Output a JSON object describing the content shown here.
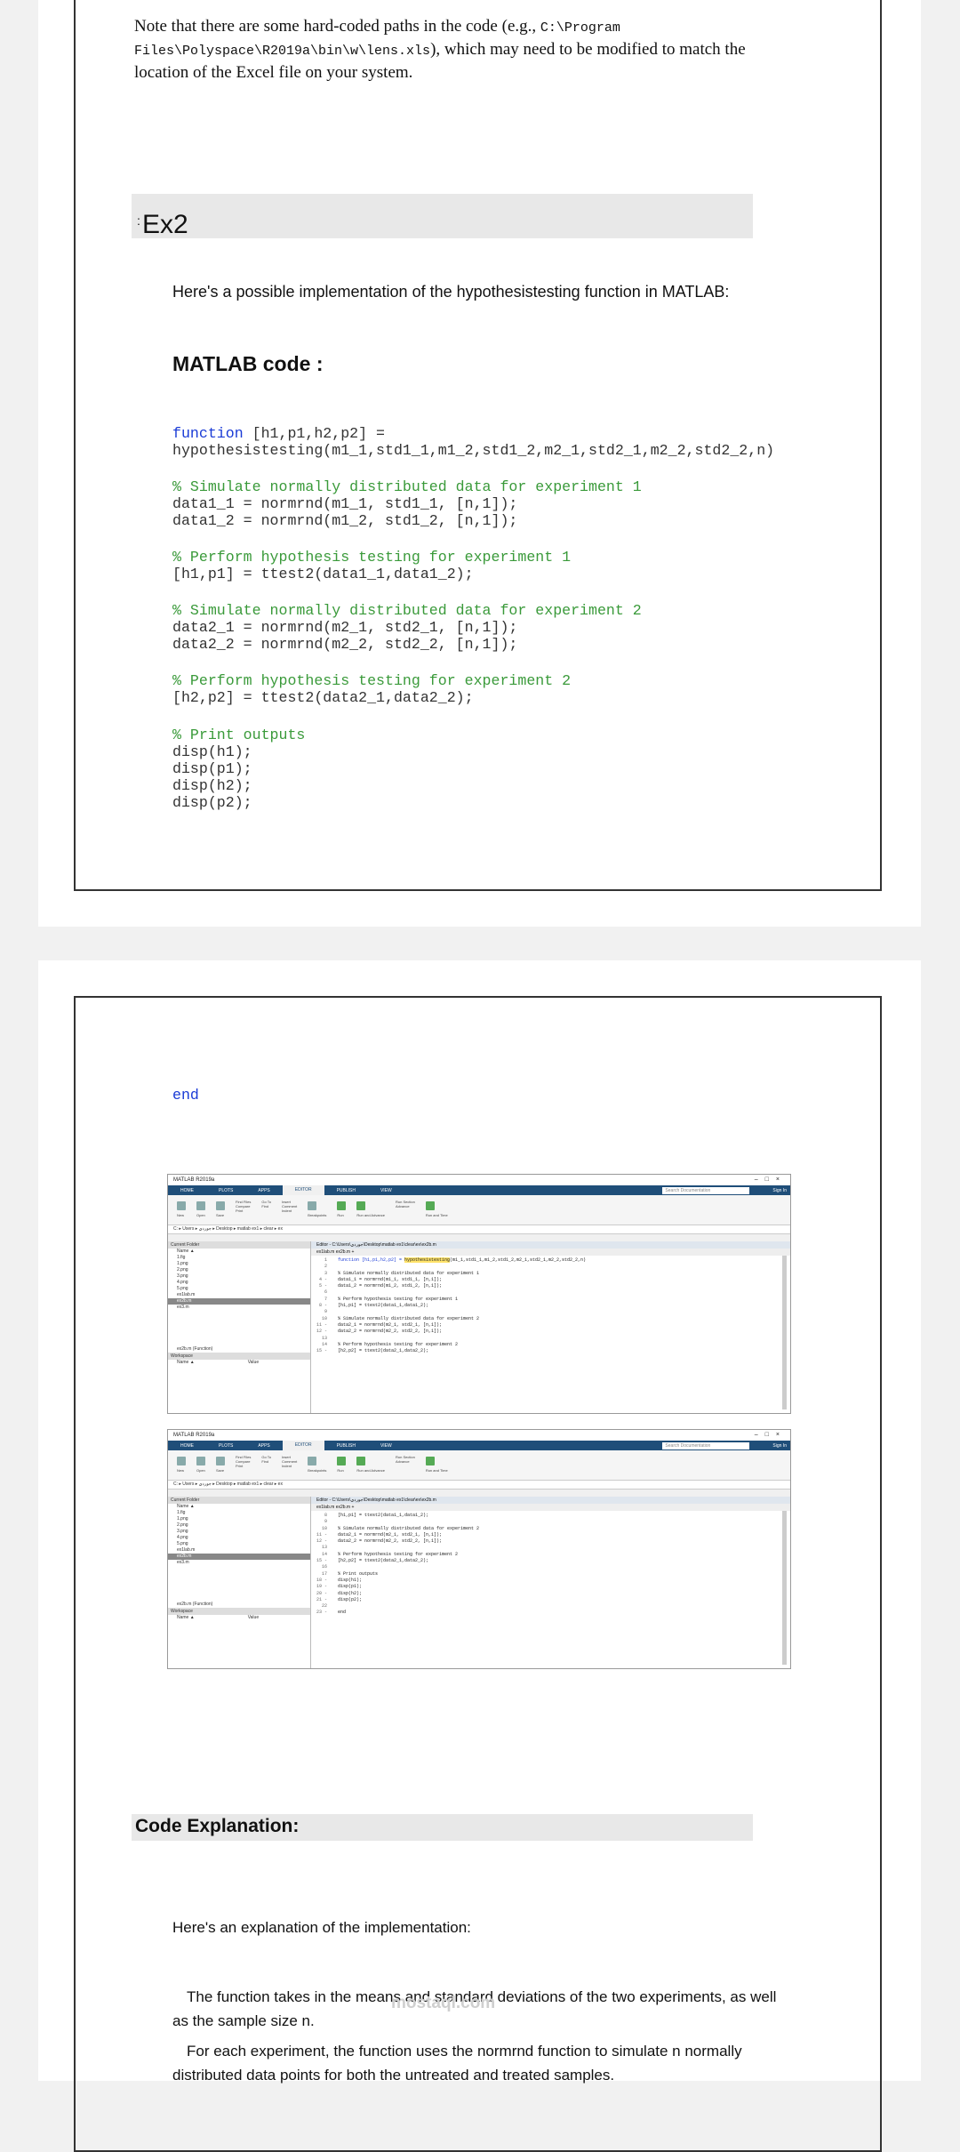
{
  "note": {
    "prefix": "Note that there are some hard-coded paths in the code (e.g., ",
    "path": "C:\\Program Files\\Polyspace\\R2019a\\bin\\w\\lens.xls",
    "suffix": "), which may need to be modified to match the location of the Excel file on your system."
  },
  "ex2": {
    "label": "Ex2",
    "colon": ":"
  },
  "intro": "Here's a possible implementation of the hypothesistesting function in MATLAB:",
  "matlab_heading": "MATLAB code :",
  "code": {
    "sig_kw": "function",
    "sig_rest": " [h1,p1,h2,p2] =",
    "sig_line2": "hypothesistesting(m1_1,std1_1,m1_2,std1_2,m2_1,std2_1,m2_2,std2_2,n)",
    "c1": "% Simulate normally distributed data for experiment 1",
    "l1": "data1_1 = normrnd(m1_1, std1_1, [n,1]);\ndata1_2 = normrnd(m1_2, std1_2, [n,1]);",
    "c2": "% Perform hypothesis testing for experiment 1",
    "l2": "[h1,p1] = ttest2(data1_1,data1_2);",
    "c3": "% Simulate normally distributed data for experiment 2",
    "l3": "data2_1 = normrnd(m2_1, std2_1, [n,1]);\ndata2_2 = normrnd(m2_2, std2_2, [n,1]);",
    "c4": "% Perform hypothesis testing for experiment 2",
    "l4": "[h2,p2] = ttest2(data2_1,data2_2);",
    "c5": "% Print outputs",
    "l5": "disp(h1);\ndisp(p1);\ndisp(h2);\ndisp(p2);",
    "end_kw": "end"
  },
  "screens": {
    "app_title": "MATLAB R2019a",
    "tabs": [
      "HOME",
      "PLOTS",
      "APPS",
      "EDITOR",
      "PUBLISH",
      "VIEW"
    ],
    "search_placeholder": "Search Documentation",
    "sign_in": "Sign In",
    "ribbon": [
      "New",
      "Open",
      "Save",
      "Find Files",
      "Compare",
      "Print",
      "Go To",
      "Find",
      "Insert",
      "Comment",
      "Indent",
      "Breakpoints",
      "Run",
      "Run and Advance",
      "Run Section",
      "Advance",
      "Run and Time"
    ],
    "address": "C: ▸ Users ▸ ‎جوردي‎ ▸ Desktop ▸ matlab ex1 ▸ clear ▸ ex",
    "current_folder": "Current Folder",
    "name_col": "Name ▲",
    "files": [
      "1.fig",
      "1.png",
      "2.png",
      "3.png",
      "4.png",
      "5.png",
      "ex1lab.m",
      "ex2b.m",
      "ex3.m"
    ],
    "function_label": "ex2b.m (Function)",
    "workspace": "Workspace",
    "ws_cols": [
      "Name ▲",
      "Value"
    ],
    "editor_path": "Editor - C:\\Users\\‎جوردي‎\\Desktop\\matlab ex1\\clear\\ex\\ex2b.m",
    "editor_tabs": [
      "ex1lab.m",
      "ex2b.m",
      "+"
    ],
    "s1_lines": "1\n2\n3\n4 -\n5 -\n6\n7\n8 -\n9\n10\n11 -\n12 -\n13\n14\n15 -",
    "s1_code_a": "function [h1,p1,h2,p2] = ",
    "s1_code_hl": "hypothesistesting",
    "s1_code_b": "(m1_1,std1_1,m1_2,std1_2,m2_1,std2_1,m2_2,std2_2,n)\n\n% Simulate normally distributed data for experiment 1\ndata1_1 = normrnd(m1_1, std1_1, [n,1]);\ndata1_2 = normrnd(m1_2, std1_2, [n,1]);\n\n% Perform hypothesis testing for experiment 1\n[h1,p1] = ttest2(data1_1,data1_2);\n\n% Simulate normally distributed data for experiment 2\ndata2_1 = normrnd(m2_1, std2_1, [n,1]);\ndata2_2 = normrnd(m2_2, std2_2, [n,1]);\n\n% Perform hypothesis testing for experiment 2\n[h2,p2] = ttest2(data2_1,data2_2);",
    "s2_lines": "8\n9\n10\n11 -\n12 -\n13\n14\n15 -\n16\n17\n18 -\n19 -\n20 -\n21 -\n22\n23 -",
    "s2_code": "[h1,p1] = ttest2(data1_1,data1_2);\n\n% Simulate normally distributed data for experiment 2\ndata2_1 = normrnd(m2_1, std2_1, [n,1]);\ndata2_2 = normrnd(m2_2, std2_2, [n,1]);\n\n% Perform hypothesis testing for experiment 2\n[h2,p2] = ttest2(data2_1,data2_2);\n\n% Print outputs\ndisp(h1);\ndisp(p1);\ndisp(h2);\ndisp(p2);\n\nend"
  },
  "explanation_heading": "Code Explanation:",
  "explanation_intro": "Here's an explanation of the implementation:",
  "explanation_p1": "The function takes in the means and standard deviations of the two experiments, as well as the sample size n.",
  "explanation_p2": "For each experiment, the function uses the normrnd function to simulate n normally distributed data points for both the untreated and treated samples.",
  "watermark": "mostaql.com"
}
